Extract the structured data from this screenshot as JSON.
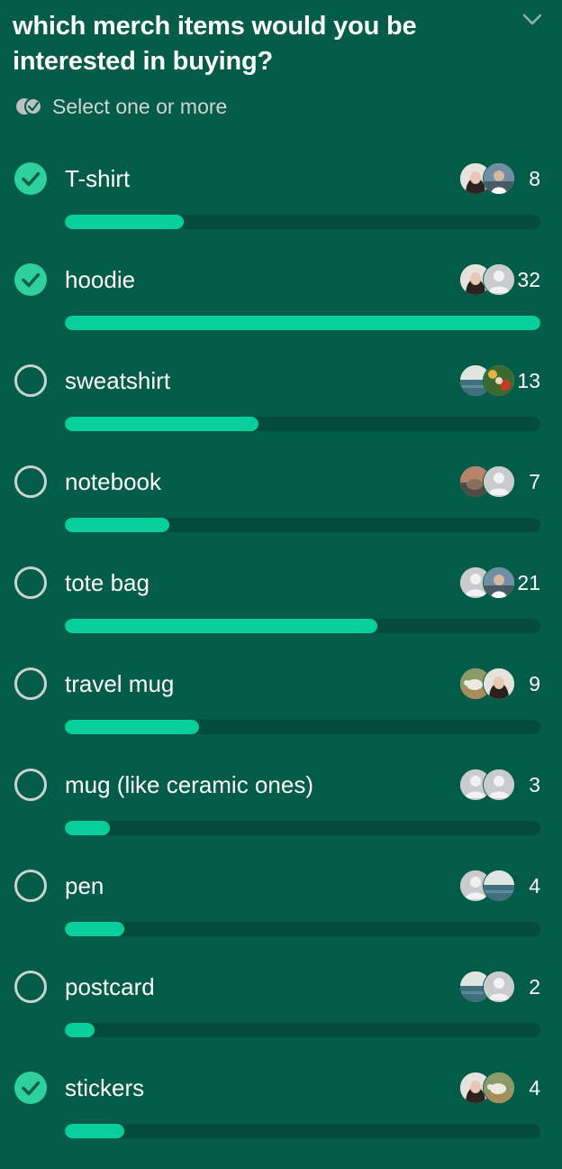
{
  "poll": {
    "question": "which merch items would you be interested in buying?",
    "subtitle": "Select one or more",
    "max_votes": 32,
    "options": [
      {
        "label": "T-shirt",
        "count": "8",
        "votes": 8,
        "selected": true,
        "avatars": [
          "photo-woman",
          "photo-man"
        ]
      },
      {
        "label": "hoodie",
        "count": "32",
        "votes": 32,
        "selected": true,
        "avatars": [
          "photo-woman",
          "default"
        ]
      },
      {
        "label": "sweatshirt",
        "count": "13",
        "votes": 13,
        "selected": false,
        "avatars": [
          "photo-ocean",
          "photo-flowers"
        ]
      },
      {
        "label": "notebook",
        "count": "7",
        "votes": 7,
        "selected": false,
        "avatars": [
          "photo-warm",
          "default"
        ]
      },
      {
        "label": "tote bag",
        "count": "21",
        "votes": 21,
        "selected": false,
        "avatars": [
          "default",
          "photo-man"
        ]
      },
      {
        "label": "travel mug",
        "count": "9",
        "votes": 9,
        "selected": false,
        "avatars": [
          "photo-sheep",
          "photo-woman"
        ]
      },
      {
        "label": "mug (like ceramic ones)",
        "count": "3",
        "votes": 3,
        "selected": false,
        "avatars": [
          "default",
          "default"
        ]
      },
      {
        "label": "pen",
        "count": "4",
        "votes": 4,
        "selected": false,
        "avatars": [
          "default",
          "photo-ocean"
        ]
      },
      {
        "label": "postcard",
        "count": "2",
        "votes": 2,
        "selected": false,
        "avatars": [
          "photo-ocean",
          "default"
        ]
      },
      {
        "label": "stickers",
        "count": "4",
        "votes": 4,
        "selected": true,
        "avatars": [
          "photo-woman",
          "photo-sheep"
        ]
      }
    ]
  },
  "icons": {
    "collapse": "chevron-down-icon",
    "multi_select": "double-check-icon",
    "checked": "check-circle-icon",
    "unchecked": "circle-outline-icon"
  },
  "colors": {
    "background": "#025c47",
    "bar_fill": "#06cf9c",
    "bar_track": "#034b3a",
    "check_fill": "#2ed19b"
  }
}
